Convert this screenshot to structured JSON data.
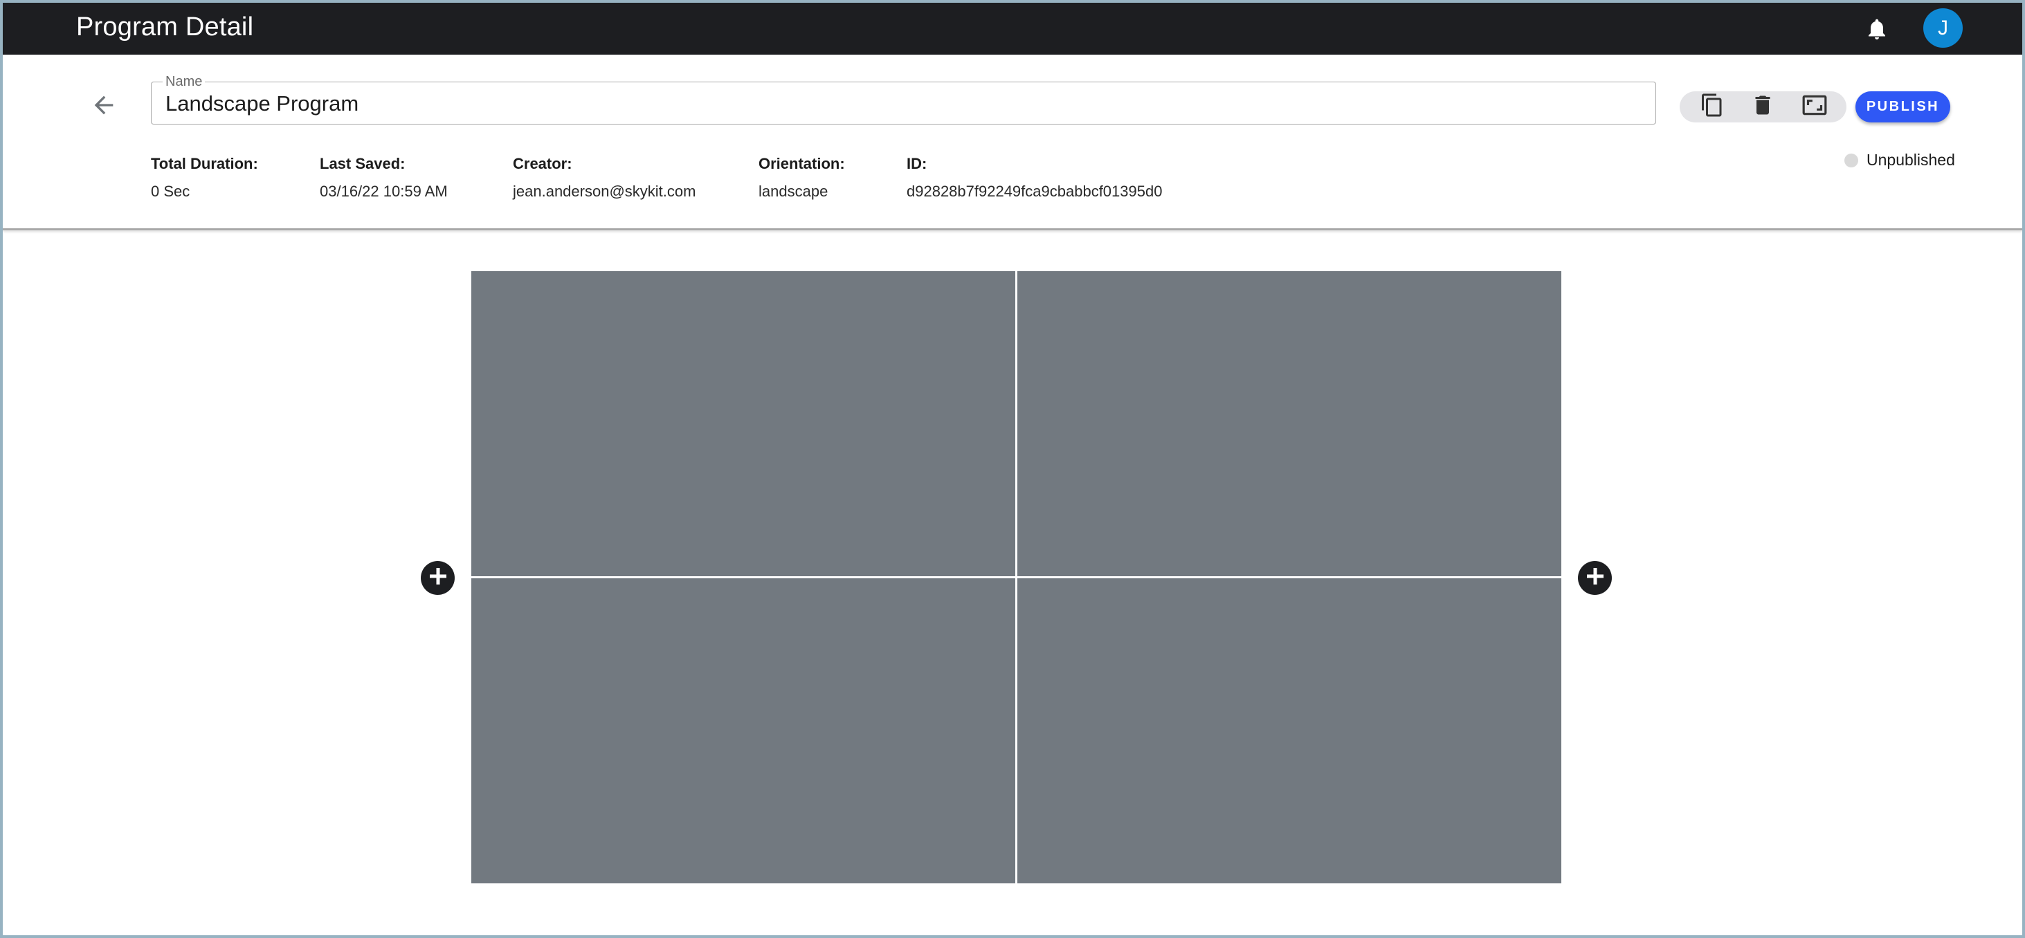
{
  "app": {
    "title": "Program Detail",
    "notifications_icon": "bell-icon",
    "avatar_initial": "J"
  },
  "program": {
    "name_label": "Name",
    "name_value": "Landscape Program",
    "back_icon": "arrow-left-icon"
  },
  "toolbar": {
    "duplicate_icon": "copy-icon",
    "delete_icon": "trash-icon",
    "fullscreen_icon": "aspect-ratio-icon",
    "publish_label": "PUBLISH"
  },
  "status": {
    "label": "Unpublished",
    "dot_color": "#d9d9d9"
  },
  "meta": [
    {
      "key": "Total Duration:",
      "value": "0 Sec"
    },
    {
      "key": "Last Saved:",
      "value": "03/16/22 10:59 AM"
    },
    {
      "key": "Creator:",
      "value": "jean.anderson@skykit.com"
    },
    {
      "key": "Orientation:",
      "value": "landscape"
    },
    {
      "key": "ID:",
      "value": "d92828b7f92249fca9cbabbcf01395d0"
    }
  ],
  "layout_grid": {
    "zones": [
      "top-left",
      "top-right",
      "bottom-left",
      "bottom-right"
    ],
    "zone_color": "#727980",
    "add_icon": "plus-circle-icon"
  },
  "colors": {
    "appbar": "#1d1e21",
    "accent": "#2f58f5",
    "avatar": "#0e88d3"
  }
}
